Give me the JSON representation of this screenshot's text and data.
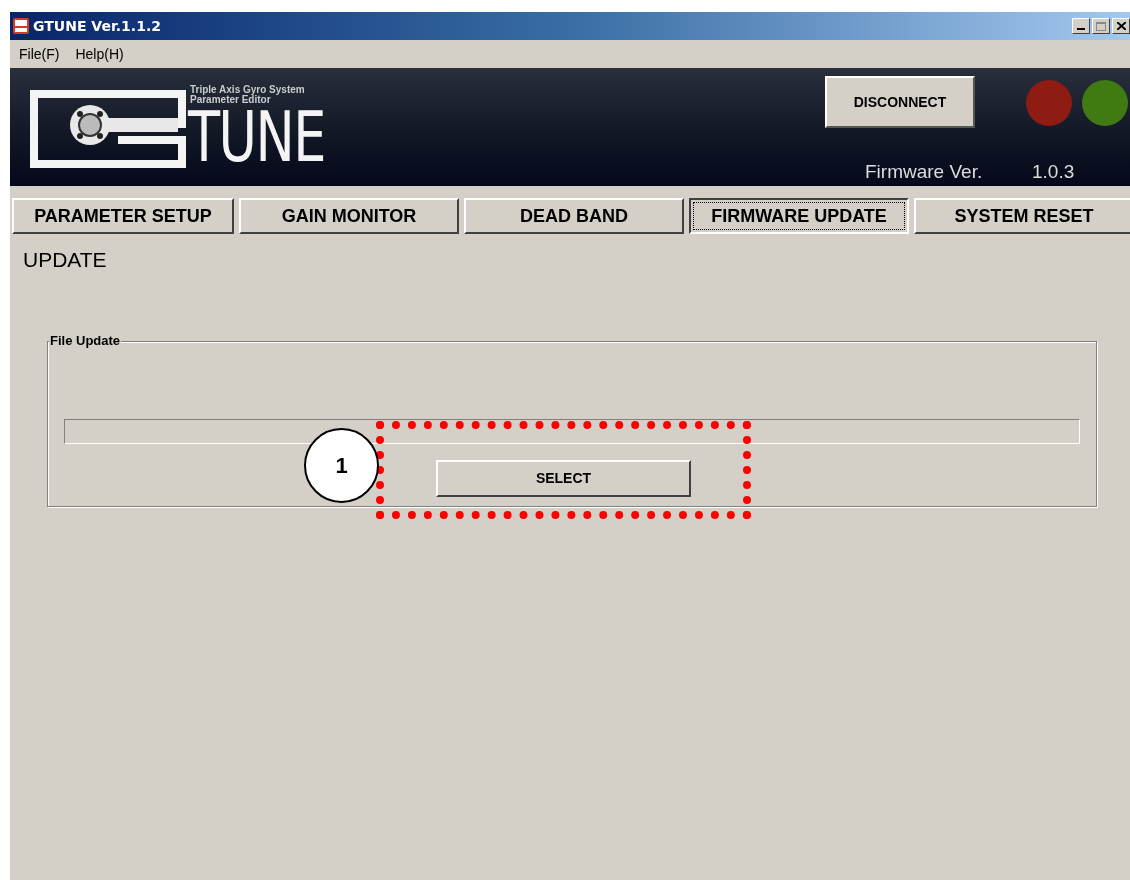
{
  "window": {
    "title": "GTUNE Ver.1.1.2"
  },
  "menu": [
    "File(F)",
    "Help(H)"
  ],
  "banner": {
    "subtitle_1": "Triple Axis Gyro System",
    "subtitle_2": "Parameter Editor",
    "logo_text": "TUNE",
    "button": "DISCONNECT",
    "lamps": [
      {
        "color": "#8e1c12"
      },
      {
        "color": "#3f7a12"
      }
    ],
    "firmware_label": "Firmware Ver.",
    "firmware_version": "1.0.3"
  },
  "tabs": [
    {
      "label": "PARAMETER SETUP",
      "selected": false
    },
    {
      "label": "GAIN MONITOR",
      "selected": false
    },
    {
      "label": "DEAD BAND",
      "selected": false
    },
    {
      "label": "FIRMWARE UPDATE",
      "selected": true
    },
    {
      "label": "SYSTEM RESET",
      "selected": false
    }
  ],
  "section_title": "UPDATE",
  "group": {
    "title": "File Update",
    "progress": {
      "level": 0
    },
    "button": "SELECT"
  },
  "annotation": {
    "number": "1"
  }
}
